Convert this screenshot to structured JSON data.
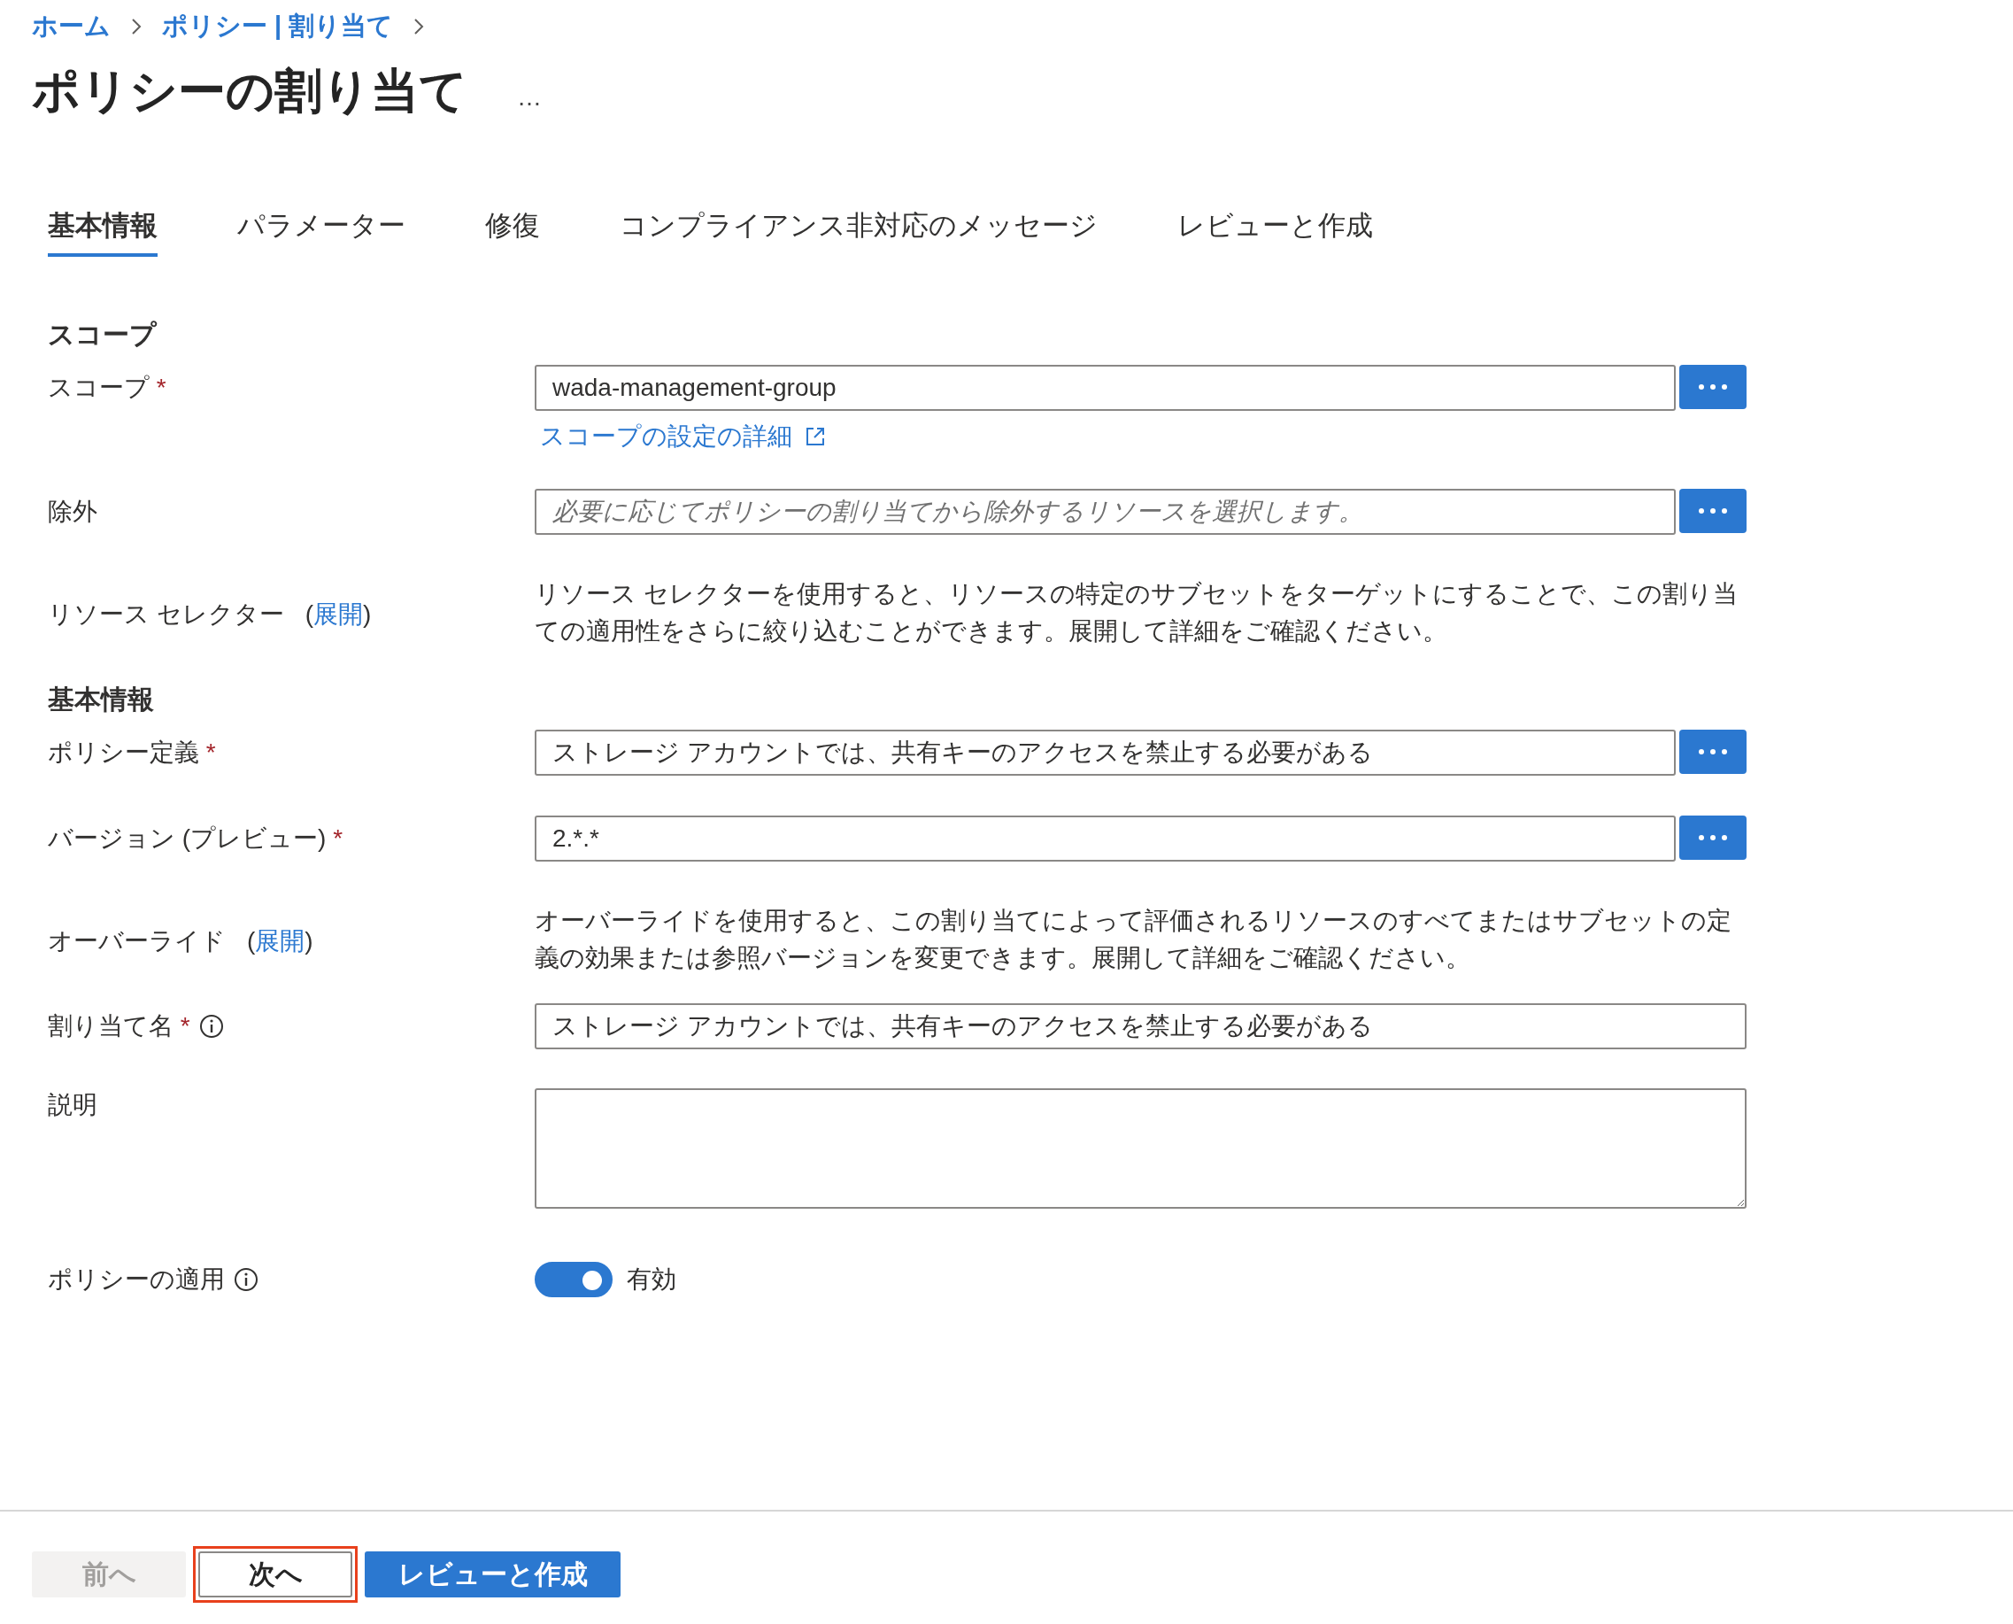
{
  "breadcrumb": [
    {
      "text": "ホーム"
    },
    {
      "text": "ポリシー | 割り当て"
    }
  ],
  "title": "ポリシーの割り当て",
  "title_more": "…",
  "tabs": [
    {
      "label": "基本情報",
      "selected": true
    },
    {
      "label": "パラメーター",
      "selected": false
    },
    {
      "label": "修復",
      "selected": false
    },
    {
      "label": "コンプライアンス非対応のメッセージ",
      "selected": false
    },
    {
      "label": "レビューと作成",
      "selected": false
    }
  ],
  "sections": [
    {
      "heading": "スコープ",
      "rows": [
        {
          "kind": "field",
          "label": "スコープ",
          "required_mark": "*",
          "value": "wada-management-group",
          "browse": true,
          "link": "スコープの設定の詳細"
        },
        {
          "kind": "field",
          "label": "除外",
          "placeholder": "必要に応じてポリシーの割り当てから除外するリソースを選択します。",
          "browse": true
        },
        {
          "kind": "info",
          "label": "リソース セレクター",
          "paren_open": "(",
          "link": "展開",
          "paren_close": ")",
          "description": "リソース セレクターを使用すると、リソースの特定のサブセットをターゲットにすることで、この割り当ての適用性をさらに絞り込むことができます。展開して詳細をご確認ください。"
        }
      ]
    },
    {
      "heading": "基本情報",
      "rows": [
        {
          "kind": "field",
          "label": "ポリシー定義",
          "required_mark": "*",
          "value": "ストレージ アカウントでは、共有キーのアクセスを禁止する必要がある",
          "browse": true
        },
        {
          "kind": "field",
          "label": "バージョン (プレビュー)",
          "required_mark": "*",
          "value": "2.*.*",
          "browse": true
        },
        {
          "kind": "info",
          "label": "オーバーライド",
          "paren_open": "(",
          "link": "展開",
          "paren_close": ")",
          "description": "オーバーライドを使用すると、この割り当てによって評価されるリソースのすべてまたはサブセットの定義の効果または参照バージョンを変更できます。展開して詳細をご確認ください。"
        },
        {
          "kind": "field",
          "label": "割り当て名",
          "required_mark": "*",
          "info": true,
          "value": "ストレージ アカウントでは、共有キーのアクセスを禁止する必要がある",
          "browse": false
        },
        {
          "kind": "textarea",
          "label": "説明"
        },
        {
          "kind": "toggle",
          "label": "ポリシーの適用",
          "info": true,
          "on": true,
          "state_label": "有効"
        }
      ]
    }
  ],
  "footer": [
    {
      "label": "前へ",
      "kind": "secondary",
      "disabled": true,
      "highlighted": false
    },
    {
      "label": "次へ",
      "kind": "secondary",
      "disabled": false,
      "highlighted": true
    },
    {
      "label": "レビューと作成",
      "kind": "primary",
      "disabled": false,
      "highlighted": false
    }
  ]
}
